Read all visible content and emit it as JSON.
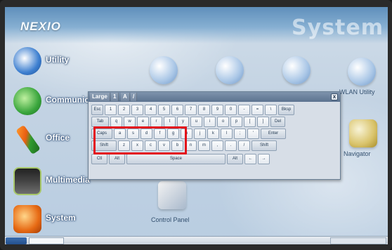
{
  "header": {
    "brand": "NEXIO",
    "title": "System"
  },
  "categories": [
    {
      "label": "Utility"
    },
    {
      "label": "Communication"
    },
    {
      "label": "Office"
    },
    {
      "label": "Multimedia"
    },
    {
      "label": "System"
    }
  ],
  "apps": {
    "wlan_utility": "WLAN Utility",
    "navigator": "Navigator",
    "control_panel": "Control Panel"
  },
  "keyboard": {
    "tabs": [
      "Large",
      "1",
      "A",
      "/"
    ],
    "close_label": "x",
    "rows": [
      [
        "Esc",
        "1",
        "2",
        "3",
        "4",
        "5",
        "6",
        "7",
        "8",
        "9",
        "0",
        "-",
        "=",
        "\\",
        "Bksp"
      ],
      [
        "Tab",
        "q",
        "w",
        "e",
        "r",
        "t",
        "y",
        "u",
        "i",
        "o",
        "p",
        "[",
        "]",
        "Del"
      ],
      [
        "Caps",
        "a",
        "s",
        "d",
        "f",
        "g",
        "h",
        "j",
        "k",
        "l",
        ";",
        "'",
        "Enter"
      ],
      [
        "Shift",
        "z",
        "x",
        "c",
        "v",
        "b",
        "n",
        "m",
        ",",
        ".",
        "/",
        "Shift"
      ],
      [
        "Ctl",
        "Alt",
        "Space",
        "Alt",
        "←",
        "→"
      ]
    ]
  },
  "colors": {
    "highlight": "#e3111a",
    "accent": "#5f8fbb"
  }
}
